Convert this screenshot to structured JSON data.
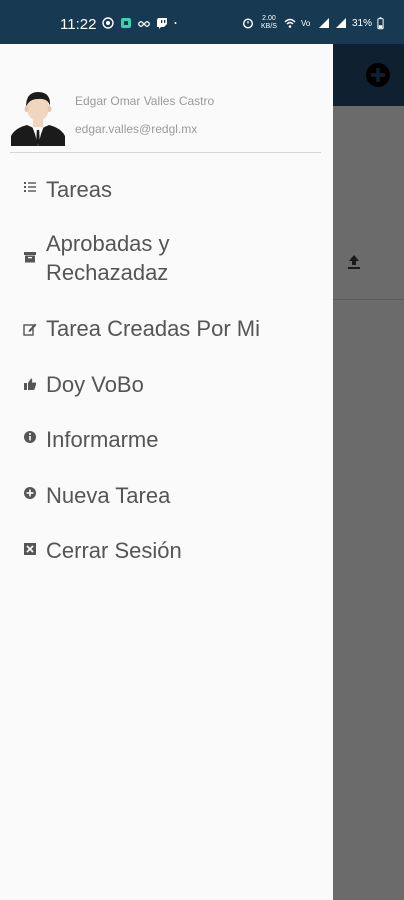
{
  "status_bar": {
    "time": "11:22",
    "data_speed": "2.00 KB/S",
    "battery": "31%",
    "left_icons": [
      "whatsapp-icon",
      "app-icon",
      "glasses-icon",
      "twitch-icon",
      "dot-icon"
    ],
    "right_icons": [
      "alarm-icon",
      "wifi-icon",
      "volte-icon",
      "signal-icon",
      "signal-icon",
      "battery-icon"
    ]
  },
  "drawer": {
    "user": {
      "name": "Edgar Omar Valles Castro",
      "email": "edgar.valles@redgl.mx",
      "avatar_icon": "user-avatar-icon"
    },
    "menu": [
      {
        "label": "Tareas",
        "icon": "tasks-list-icon"
      },
      {
        "label": "Aprobadas y Rechazadaz",
        "icon": "archive-box-icon"
      },
      {
        "label": "Tarea Creadas Por Mi",
        "icon": "edit-icon"
      },
      {
        "label": "Doy VoBo",
        "icon": "thumbs-up-icon"
      },
      {
        "label": "Informarme",
        "icon": "info-icon"
      },
      {
        "label": "Nueva Tarea",
        "icon": "plus-circle-icon"
      },
      {
        "label": "Cerrar Sesión",
        "icon": "close-box-icon"
      }
    ]
  },
  "background_app": {
    "add_icon": "add-circle-icon",
    "upload_icon": "upload-icon"
  },
  "colors": {
    "status_bar": "#173a52",
    "drawer_bg": "#fafafa",
    "scrim": "#6b6b6b",
    "menu_text": "#555555",
    "header_text": "#9a9a9a"
  }
}
